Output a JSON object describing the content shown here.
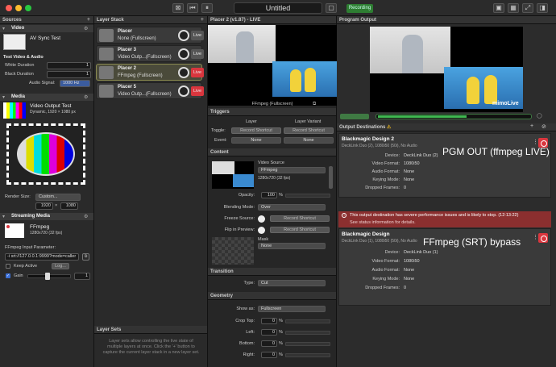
{
  "window": {
    "title": "Untitled",
    "live_pill": "Recording"
  },
  "sources": {
    "header": "Sources",
    "video_section": "Video",
    "av_sync_title": "AV Sync Test",
    "test_group": "Test Video & Audio",
    "white_duration_label": "White Duration",
    "white_duration_value": "1",
    "black_duration_label": "Black Duration",
    "black_duration_value": "1",
    "audio_signal_label": "Audio Signal:",
    "audio_signal_value": "1000 Hz",
    "media_section": "Media",
    "vot_title": "Video Output Test",
    "vot_sub": "Dynamic, 1920 × 1080 px",
    "render_size_label": "Render Size:",
    "render_size_value": "Custom...",
    "render_w": "1920",
    "render_x": "×",
    "render_h": "1080",
    "streaming_section": "Streaming Media",
    "ffmpeg_title": "FFmpeg",
    "ffmpeg_sub": "1280x720 (32 fps)",
    "ffmpeg_param_label": "FFmpeg Input Parameter:",
    "ffmpeg_param_value": "-i srt://127.0.0.1:9999?mode=caller",
    "keep_active": "Keep Active",
    "log_button": "Log...",
    "gain_label": "Gain",
    "gain_value": "1"
  },
  "layer_stack": {
    "header": "Layer Stack",
    "layers": [
      {
        "name": "Placer",
        "sub": "None (Fullscreen)",
        "live": "Live"
      },
      {
        "name": "Placer 3",
        "sub": "Video Outp...(Fullscreen)",
        "live": "Live"
      },
      {
        "name": "Placer 2",
        "sub": "FFmpeg (Fullscreen)",
        "live": "Live"
      },
      {
        "name": "Placer 5",
        "sub": "Video Outp...(Fullscreen)",
        "live": "Live"
      }
    ],
    "layer_sets_header": "Layer Sets",
    "layer_sets_help": "Layer sets allow controlling the live state of multiple layers at once. Click the '+' button to capture the current layer stack in a new layer set."
  },
  "inspector": {
    "header": "Placer 2 (v1.87) - LIVE",
    "preview_caption": "FFmpeg (Fullscreen)",
    "triggers": "Triggers",
    "layer_col": "Layer",
    "variant_col": "Layer Variant",
    "toggle_label": "Toggle:",
    "record_shortcut": "Record Shortcut",
    "event_label": "Event:",
    "event_value": "None",
    "content": "Content",
    "video_source_label": "Video Source",
    "video_source_value": "FFmpeg",
    "video_source_sub": "1280x720 (32 fps)",
    "opacity_label": "Opacity:",
    "opacity_value": "100",
    "pct": "%",
    "blending_label": "Blending Mode:",
    "blending_value": "Over",
    "freeze_label": "Freeze Source:",
    "flip_label": "Flip in Preview:",
    "mask_label": "Mask",
    "mask_value": "None",
    "transition": "Transition",
    "type_label": "Type:",
    "type_value": "Cut",
    "geometry": "Geometry",
    "show_as_label": "Show as:",
    "show_as_value": "Fullscreen",
    "crop_top": "Crop Top:",
    "left": "Left:",
    "bottom": "Bottom:",
    "right": "Right:",
    "zero": "0"
  },
  "program": {
    "header": "Program Output",
    "watermark": "mimoLive",
    "destinations_header": "Output Destinations",
    "dest1": {
      "title": "Blackmagic Design 2",
      "sub": "DeckLink Duo (2), 1080i50 (50i), No Audio",
      "device_k": "Device:",
      "device_v": "DeckLink Duo (2)",
      "vf_k": "Video Format:",
      "vf_v": "1080i50",
      "af_k": "Audio Format:",
      "af_v": "None",
      "km_k": "Keying Mode:",
      "km_v": "None",
      "df_k": "Dropped Frames:",
      "df_v": "0",
      "annotation": "PGM OUT (ffmpeg LIVE)"
    },
    "warning": "This output destination has severe performance issues and is likely to stop. (12:13:22)",
    "warning_sub": "See status information for details.",
    "dest2": {
      "title": "Blackmagic Design",
      "sub": "DeckLink Duo (1), 1080i50 (50i), No Audio",
      "device_k": "Device:",
      "device_v": "DeckLink Duo (1)",
      "vf_k": "Video Format:",
      "vf_v": "1080i50",
      "af_k": "Audio Format:",
      "af_v": "None",
      "km_k": "Keying Mode:",
      "km_v": "None",
      "df_k": "Dropped Frames:",
      "df_v": "0",
      "annotation": "FFmpeg (SRT) bypass"
    }
  }
}
